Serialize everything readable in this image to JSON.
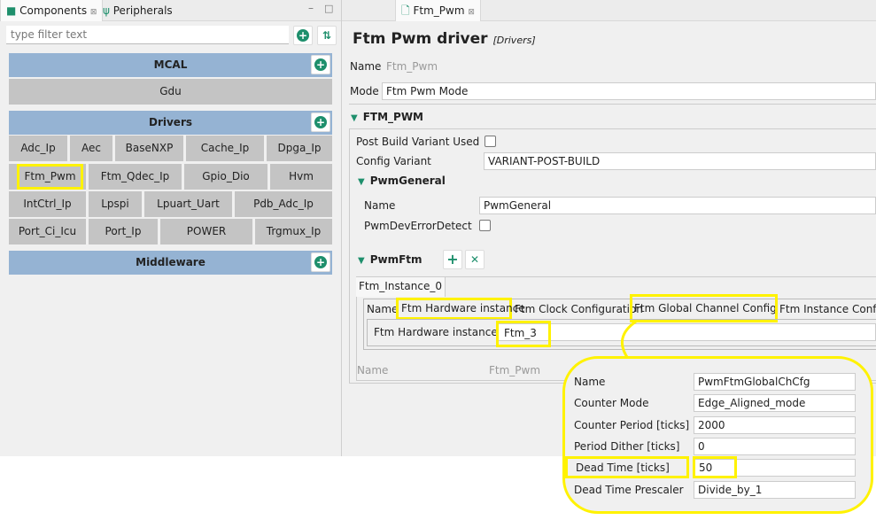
{
  "left_panel": {
    "tabs": [
      {
        "label": "Components",
        "icon": "components-icon"
      },
      {
        "label": "Peripherals",
        "icon": "usb-icon"
      }
    ],
    "filter_placeholder": "type filter text",
    "groups": [
      {
        "title": "MCAL",
        "items": [
          "Gdu"
        ]
      },
      {
        "title": "Drivers",
        "items": [
          "Adc_Ip",
          "Aec",
          "BaseNXP",
          "Cache_Ip",
          "Dpga_Ip",
          "Ftm_Pwm",
          "Ftm_Qdec_Ip",
          "Gpio_Dio",
          "Hvm",
          "IntCtrl_Ip",
          "Lpspi",
          "Lpuart_Uart",
          "Pdb_Adc_Ip",
          "Port_Ci_Icu",
          "Port_Ip",
          "POWER",
          "Trgmux_Ip"
        ]
      },
      {
        "title": "Middleware",
        "items": []
      }
    ],
    "highlighted_item": "Ftm_Pwm"
  },
  "editor": {
    "tab": "Ftm_Pwm",
    "title": "Ftm Pwm driver",
    "category": "[Drivers]",
    "name_label": "Name",
    "name_value": "Ftm_Pwm",
    "mode_label": "Mode",
    "mode_value": "Ftm Pwm Mode",
    "section": "FTM_PWM",
    "post_build_label": "Post Build Variant Used",
    "post_build_checked": false,
    "config_variant_label": "Config Variant",
    "config_variant_value": "VARIANT-POST-BUILD",
    "pwm_general": {
      "title": "PwmGeneral",
      "name_label": "Name",
      "name_value": "PwmGeneral",
      "dev_error_label": "PwmDevErrorDetect",
      "dev_error_checked": false
    },
    "pwm_ftm": {
      "title": "PwmFtm",
      "instance_tab": "Ftm_Instance_0",
      "subtabs": [
        "Name",
        "Ftm Hardware instance",
        "Ftm Clock Configuration",
        "Ftm Global Channel Configu...",
        "Ftm Instance Configu"
      ],
      "hw_instance_label": "Ftm Hardware instance",
      "hw_instance_value": "Ftm_3"
    },
    "footer_name_label": "Name",
    "footer_name_value": "Ftm_Pwm"
  },
  "callout": {
    "rows": [
      {
        "label": "Name",
        "value": "PwmFtmGlobalChCfg"
      },
      {
        "label": "Counter Mode",
        "value": "Edge_Aligned_mode"
      },
      {
        "label": "Counter Period [ticks]",
        "value": "2000"
      },
      {
        "label": "Period Dither [ticks]",
        "value": "0"
      },
      {
        "label": "Dead Time [ticks]",
        "value": "50"
      },
      {
        "label": "Dead Time Prescaler",
        "value": "Divide_by_1"
      }
    ]
  },
  "colors": {
    "highlight": "#fff200",
    "header": "#95b3d3",
    "accent": "#1e8f6c"
  }
}
